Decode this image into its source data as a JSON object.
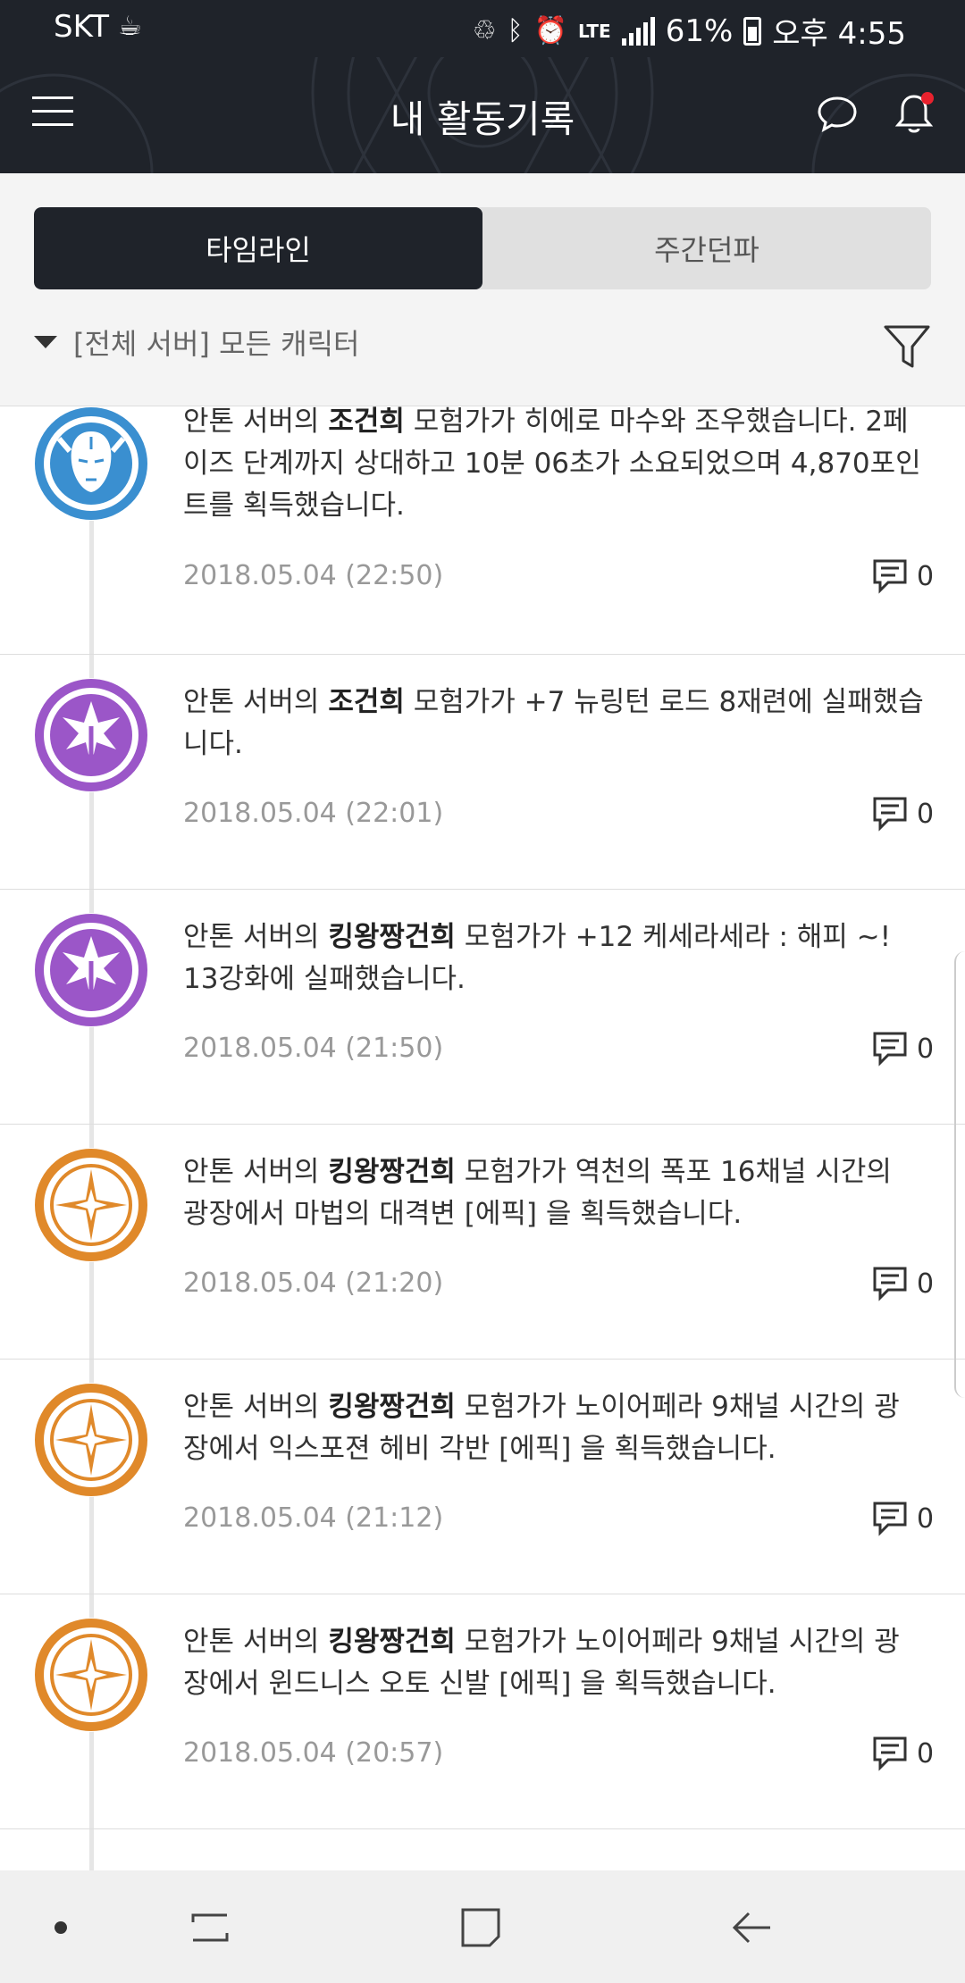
{
  "status_bar": {
    "carrier": "SKT",
    "network": "LTE",
    "battery": "61%",
    "time": "오후 4:55"
  },
  "header": {
    "title": "내 활동기록"
  },
  "tabs": [
    {
      "label": "타임라인",
      "active": true
    },
    {
      "label": "주간던파",
      "active": false
    }
  ],
  "filter": {
    "label": "[전체 서버] 모든 캐릭터"
  },
  "feed": [
    {
      "icon": "blue-character-emblem-icon",
      "pre": "안톤 서버의 ",
      "name": "조건희",
      "post": " 모험가가 히에로 마수와 조우했습니다. 2페이즈 단계까지 상대하고 10분 06초가 소요되었으며 4,870포인트를 획득했습니다.",
      "date": "2018.05.04 (22:50)",
      "comments": "0"
    },
    {
      "icon": "purple-enhance-fail-emblem-icon",
      "pre": "안톤 서버의 ",
      "name": "조건희",
      "post": " 모험가가 +7 뉴링턴 로드 8재련에 실패했습니다.",
      "date": "2018.05.04 (22:01)",
      "comments": "0"
    },
    {
      "icon": "purple-enhance-fail-emblem-icon",
      "pre": "안톤 서버의 ",
      "name": "킹왕짱건희",
      "post": " 모험가가 +12 케세라세라 : 해피 ~! 13강화에 실패했습니다.",
      "date": "2018.05.04 (21:50)",
      "comments": "0"
    },
    {
      "icon": "orange-epic-star-emblem-icon",
      "pre": "안톤 서버의 ",
      "name": "킹왕짱건희",
      "post": " 모험가가 역천의 폭포 16채널 시간의 광장에서 마법의 대격변 [에픽] 을 획득했습니다.",
      "date": "2018.05.04 (21:20)",
      "comments": "0"
    },
    {
      "icon": "orange-epic-star-emblem-icon",
      "pre": "안톤 서버의 ",
      "name": "킹왕짱건희",
      "post": " 모험가가 노이어페라 9채널 시간의 광장에서 익스포젼 헤비 각반 [에픽] 을 획득했습니다.",
      "date": "2018.05.04 (21:12)",
      "comments": "0"
    },
    {
      "icon": "orange-epic-star-emblem-icon",
      "pre": "안톤 서버의 ",
      "name": "킹왕짱건희",
      "post": " 모험가가 노이어페라 9채널 시간의 광장에서 윈드니스 오토 신발 [에픽] 을 획득했습니다.",
      "date": "2018.05.04 (20:57)",
      "comments": "0"
    }
  ],
  "colors": {
    "header_bg": "#1f232a",
    "blue": "#3a8fd0",
    "purple": "#9b56c8",
    "orange": "#e0892a",
    "notification_dot": "#e8222e"
  }
}
